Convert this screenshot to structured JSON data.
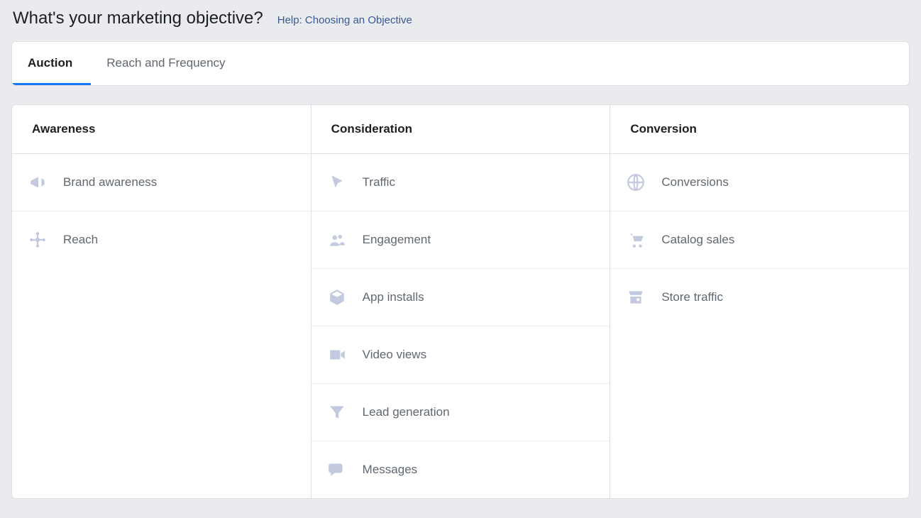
{
  "header": {
    "title": "What's your marketing objective?",
    "help_label": "Help: Choosing an Objective"
  },
  "tabs": {
    "auction": "Auction",
    "reach_freq": "Reach and Frequency"
  },
  "columns": {
    "awareness": {
      "title": "Awareness",
      "items": {
        "brand_awareness": "Brand awareness",
        "reach": "Reach"
      }
    },
    "consideration": {
      "title": "Consideration",
      "items": {
        "traffic": "Traffic",
        "engagement": "Engagement",
        "app_installs": "App installs",
        "video_views": "Video views",
        "lead_generation": "Lead generation",
        "messages": "Messages"
      }
    },
    "conversion": {
      "title": "Conversion",
      "items": {
        "conversions": "Conversions",
        "catalog_sales": "Catalog sales",
        "store_traffic": "Store traffic"
      }
    }
  }
}
